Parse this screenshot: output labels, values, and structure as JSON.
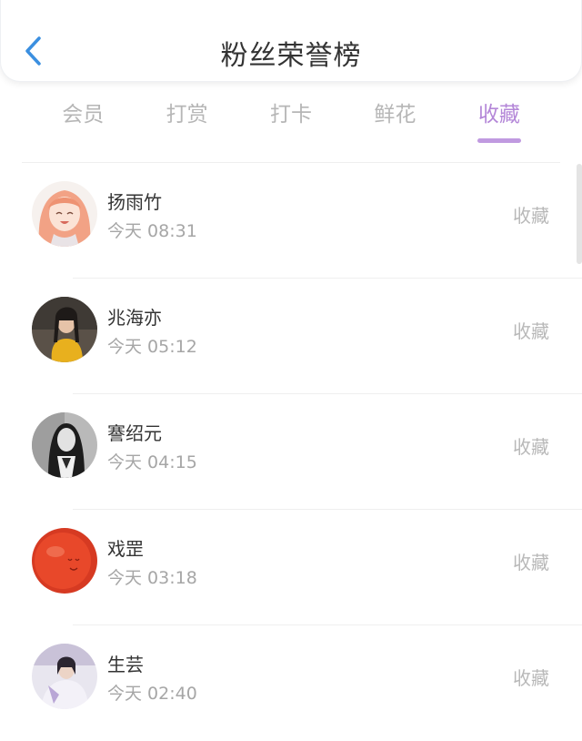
{
  "header": {
    "title": "粉丝荣誉榜"
  },
  "tabs": [
    {
      "label": "会员",
      "active": false
    },
    {
      "label": "打赏",
      "active": false
    },
    {
      "label": "打卡",
      "active": false
    },
    {
      "label": "鲜花",
      "active": false
    },
    {
      "label": "收藏",
      "active": true
    }
  ],
  "fans": [
    {
      "name": "扬雨竹",
      "time": "今天 08:31",
      "action": "收藏"
    },
    {
      "name": "兆海亦",
      "time": "今天 05:12",
      "action": "收藏"
    },
    {
      "name": "謇绍元",
      "time": "今天 04:15",
      "action": "收藏"
    },
    {
      "name": "戏罡",
      "time": "今天 03:18",
      "action": "收藏"
    },
    {
      "name": "生芸",
      "time": "今天 02:40",
      "action": "收藏"
    }
  ],
  "colors": {
    "accent": "#b487d8",
    "back_arrow": "#3b8fe0",
    "inactive_tab": "#b6b6b6"
  }
}
